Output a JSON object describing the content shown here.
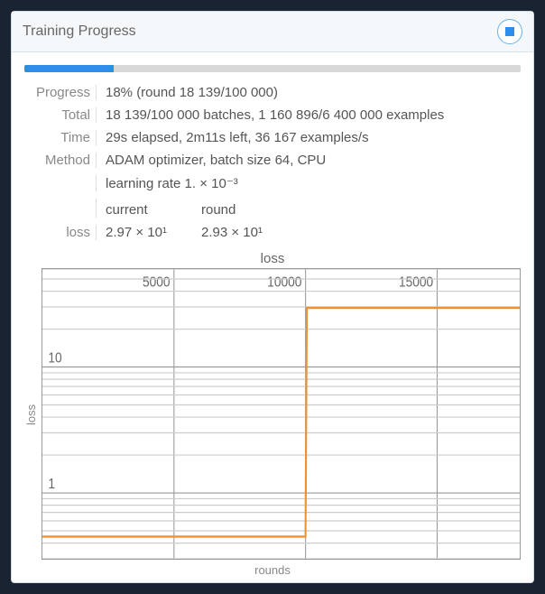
{
  "header": {
    "title": "Training Progress",
    "stop_icon": "stop-icon"
  },
  "progress_percent": 18,
  "rows": {
    "progress_label": "Progress",
    "progress_value": "18% (round 18 139/100 000)",
    "total_label": "Total",
    "total_value": "18 139/100 000 batches, 1 160 896/6 400 000 examples",
    "time_label": "Time",
    "time_value": "29s elapsed, 2m11s left, 36 167 examples/s",
    "method_label": "Method",
    "method_value": "ADAM optimizer, batch size 64, CPU",
    "lr_value": "learning rate 1. × 10⁻³",
    "col_current": "current",
    "col_round": "round",
    "loss_label": "loss",
    "loss_current": "2.97 × 10¹",
    "loss_round": "2.93 × 10¹"
  },
  "chart_data": {
    "type": "line",
    "title": "loss",
    "xlabel": "rounds",
    "ylabel": "loss",
    "x_ticks": [
      5000,
      10000,
      15000
    ],
    "y_ticks_log": [
      1,
      10
    ],
    "xlim": [
      0,
      18139
    ],
    "ylim_log": [
      0.3,
      60
    ],
    "series": [
      {
        "name": "loss",
        "x": [
          0,
          5000,
          10000,
          10050,
          15000,
          18139
        ],
        "y": [
          0.45,
          0.45,
          0.45,
          29.5,
          29.5,
          29.5
        ]
      }
    ]
  }
}
